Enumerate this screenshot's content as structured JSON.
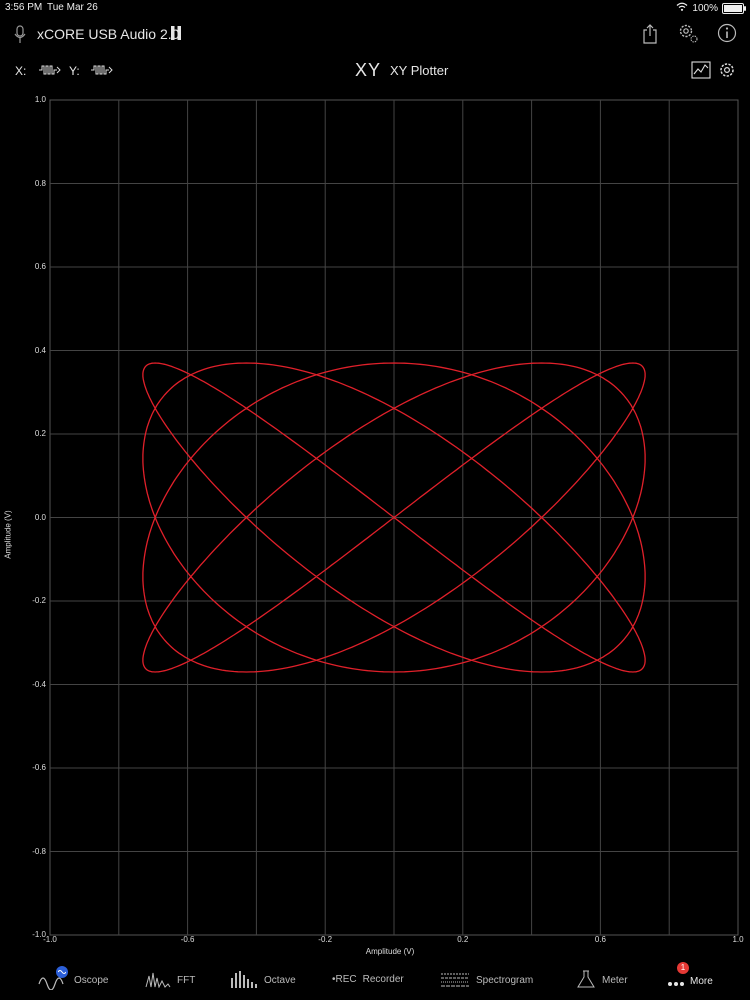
{
  "status_bar": {
    "time": "3:56 PM",
    "date": "Tue Mar 26",
    "battery": "100%",
    "battery_level": 1.0
  },
  "header": {
    "device_name": "xCORE USB Audio 2.0",
    "icons": [
      "microphone-icon",
      "pause-icon",
      "share-icon",
      "settings-gear-icon",
      "info-icon"
    ]
  },
  "subheader": {
    "x_label": "X:",
    "y_label": "Y:",
    "mode_glyph": "XY",
    "title": "XY Plotter"
  },
  "tabs": [
    {
      "label": "Oscope",
      "icon": "oscope-wave-icon"
    },
    {
      "label": "FFT",
      "icon": "fft-icon"
    },
    {
      "label": "Octave",
      "icon": "octave-bars-icon"
    },
    {
      "label": "Recorder",
      "icon": "rec-icon",
      "prefix": "•REC"
    },
    {
      "label": "Spectrogram",
      "icon": "spectrogram-icon"
    },
    {
      "label": "Meter",
      "icon": "meter-flask-icon"
    },
    {
      "label": "More",
      "icon": "more-dots-icon",
      "badge": "1"
    }
  ],
  "chart_data": {
    "type": "line",
    "xlabel": "Amplitude (V)",
    "ylabel": "Amplitude (V)",
    "xlim": [
      -1.0,
      1.0
    ],
    "ylim": [
      -1.0,
      1.0
    ],
    "x_ticks": [
      "-1.0",
      "-0.6",
      "-0.2",
      "0.2",
      "0.6",
      "1.0"
    ],
    "y_ticks": [
      "1.0",
      "0.8",
      "0.6",
      "0.4",
      "0.2",
      "0.0",
      "-0.2",
      "-0.4",
      "-0.6",
      "-0.8",
      "-1.0"
    ],
    "grid": true,
    "trace_color": "#e0202a",
    "series": [
      {
        "description_type": "lissajous",
        "x_amplitude": 0.73,
        "y_amplitude": 0.37,
        "x_frequency": 4,
        "y_frequency": 5
      }
    ]
  }
}
